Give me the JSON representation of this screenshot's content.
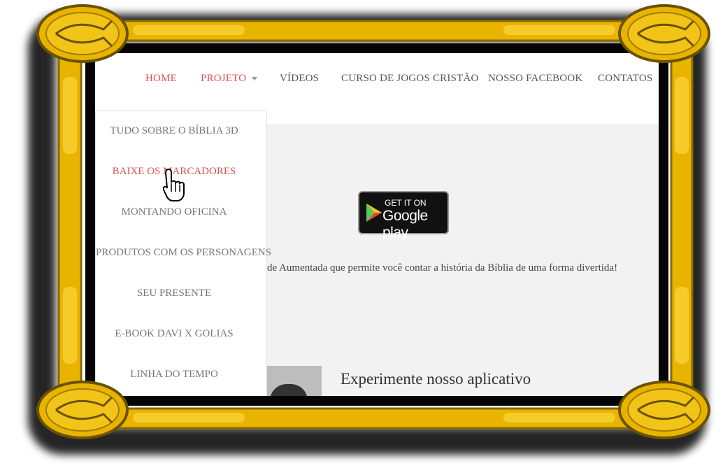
{
  "nav": {
    "items": [
      {
        "label": "HOME",
        "active": true
      },
      {
        "label": "PROJETO",
        "active": true,
        "has_dropdown": true
      },
      {
        "label": "VÍDEOS",
        "active": false
      },
      {
        "label": "CURSO DE JOGOS CRISTÃO",
        "active": false
      },
      {
        "label": "NOSSO FACEBOOK",
        "active": false
      },
      {
        "label": "CONTATOS",
        "active": false
      }
    ]
  },
  "dropdown": {
    "items": [
      {
        "label": "TUDO SOBRE O BÍBLIA 3D",
        "hover": false
      },
      {
        "label": "BAIXE OS MARCADORES",
        "hover": true
      },
      {
        "label": "MONTANDO OFICINA",
        "hover": false
      },
      {
        "label": "PRODUTOS COM OS PERSONAGENS",
        "hover": false
      },
      {
        "label": "SEU PRESENTE",
        "hover": false
      },
      {
        "label": "E-BOOK DAVI X GOLIAS",
        "hover": false
      },
      {
        "label": "LINHA DO TEMPO",
        "hover": false
      }
    ]
  },
  "store_badge": {
    "line1": "GET IT ON",
    "line2": "Google play"
  },
  "description": "de Aumentada que permite você contar a história da Bíblia de uma forma divertida!",
  "section_heading": "Experimente nosso aplicativo",
  "colors": {
    "accent": "#d9534f",
    "frame_gold": "#e8b400",
    "frame_dark": "#8a6a00"
  },
  "icons": {
    "corner": "fish-icon",
    "cursor": "hand-pointer-icon",
    "store": "google-play-icon"
  }
}
